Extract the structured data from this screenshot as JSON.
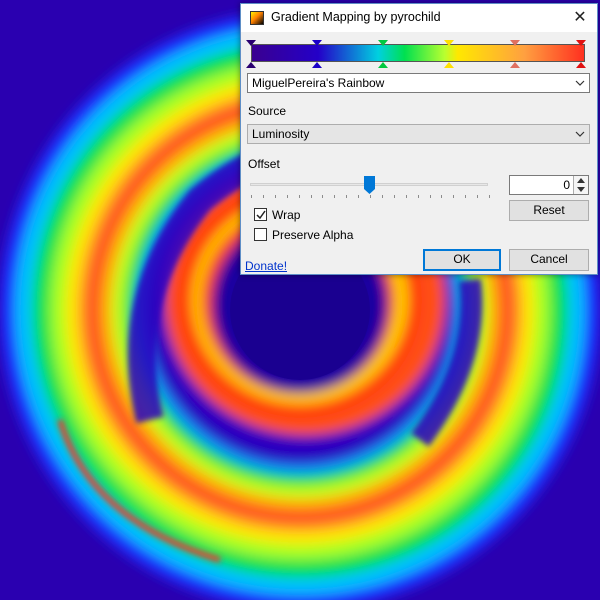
{
  "dialog": {
    "title": "Gradient Mapping by pyrochild",
    "close_glyph": "✕",
    "preset": {
      "selected": "MiguelPereira's Rainbow"
    },
    "source": {
      "label": "Source",
      "selected": "Luminosity"
    },
    "offset": {
      "label": "Offset",
      "value": "0",
      "slider_fraction": 0.5
    },
    "reset_label": "Reset",
    "wrap": {
      "label": "Wrap",
      "checked": true
    },
    "preserve_alpha": {
      "label": "Preserve Alpha",
      "checked": false
    },
    "donate_label": "Donate!",
    "ok_label": "OK",
    "cancel_label": "Cancel",
    "gradient_stops": [
      {
        "color": "#2a0070"
      },
      {
        "color": "#1a00c8"
      },
      {
        "color": "#00c840"
      },
      {
        "color": "#ffe000"
      },
      {
        "color": "#e07060"
      },
      {
        "color": "#e01010"
      }
    ]
  }
}
